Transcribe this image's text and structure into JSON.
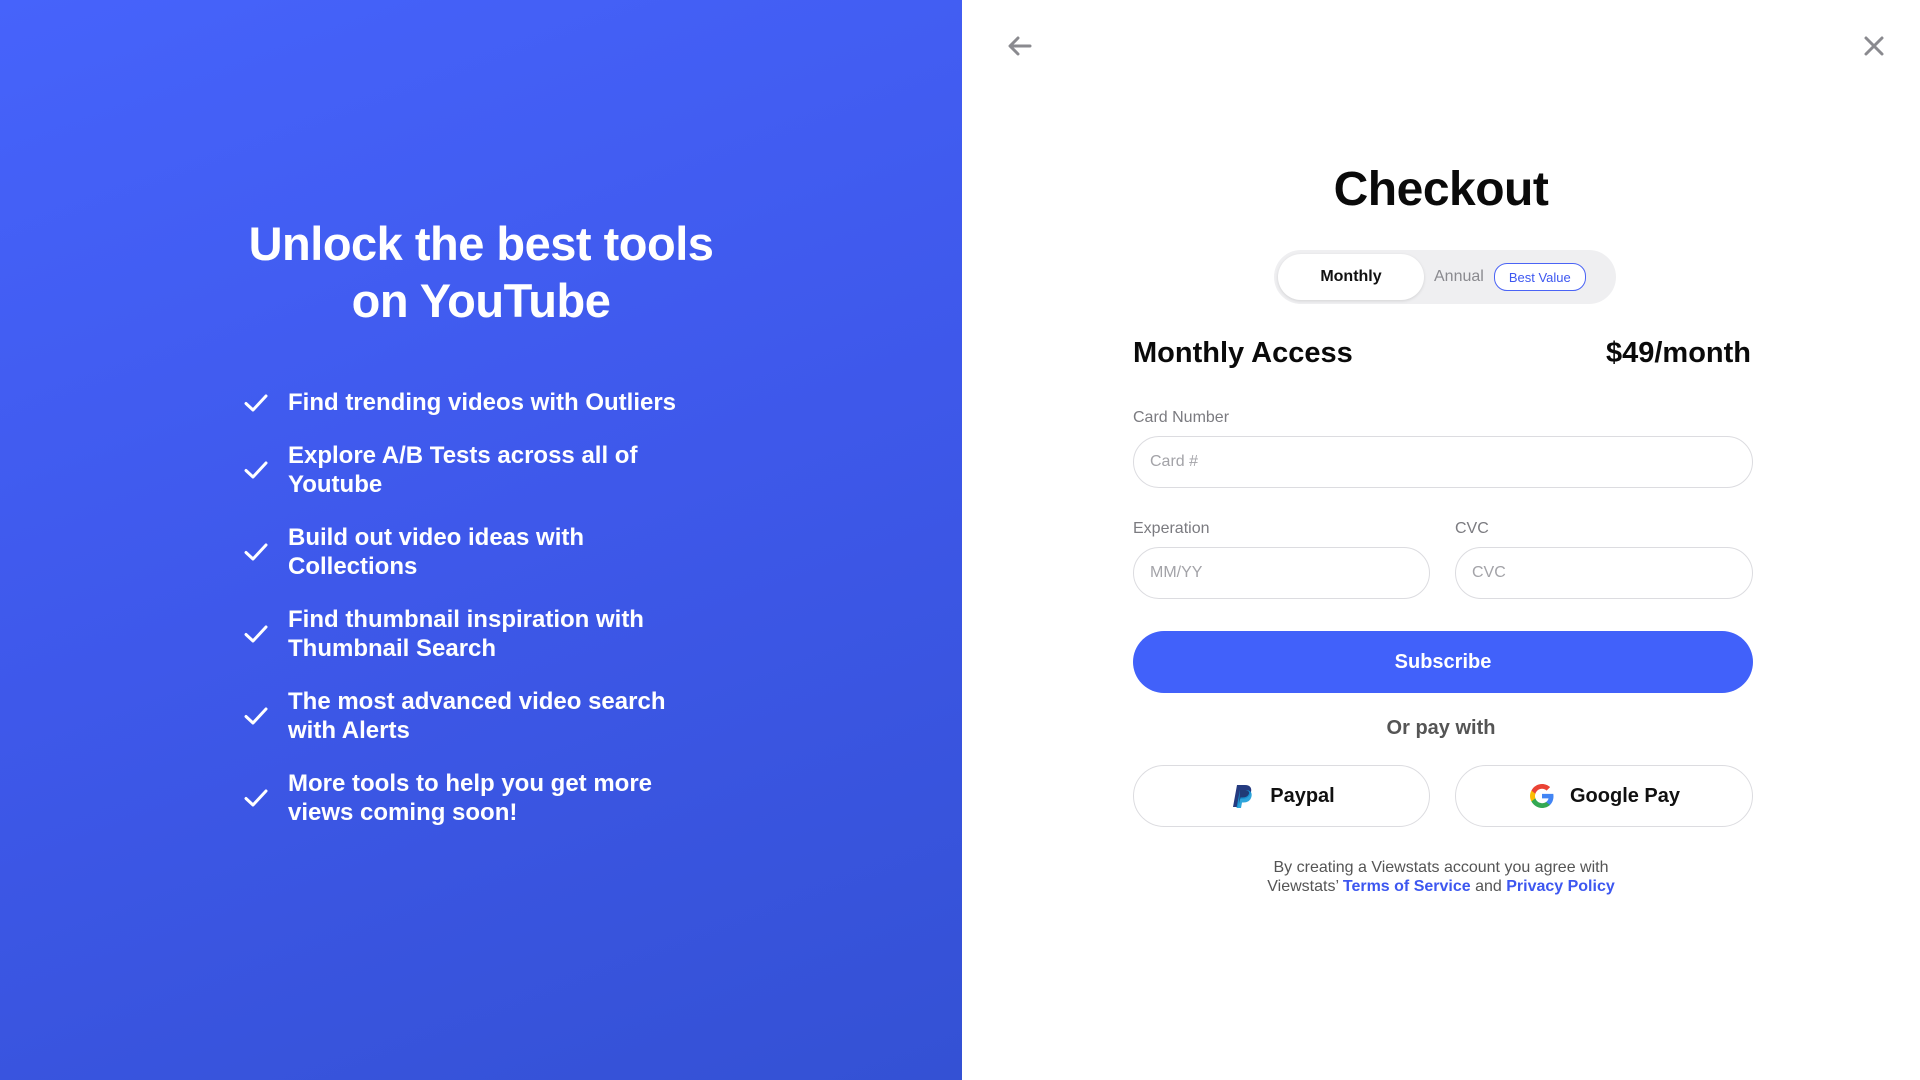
{
  "left": {
    "headline_line1": "Unlock the best tools",
    "headline_line2": "on YouTube",
    "features": [
      "Find trending videos with Outliers",
      "Explore A/B Tests across all of Youtube",
      "Build out video ideas with Collections",
      "Find thumbnail inspiration with Thumbnail Search",
      "The most advanced video search with Alerts",
      "More tools to help you get more views coming soon!"
    ]
  },
  "checkout": {
    "title": "Checkout",
    "toggle": {
      "monthly": "Monthly",
      "annual": "Annual",
      "badge": "Best Value"
    },
    "plan_name": "Monthly Access",
    "plan_price": "$49/month",
    "card_number_label": "Card Number",
    "card_number_placeholder": "Card #",
    "expiration_label": "Experation",
    "expiration_placeholder": "MM/YY",
    "cvc_label": "CVC",
    "cvc_placeholder": "CVC",
    "subscribe_label": "Subscribe",
    "or_pay_with": "Or pay with",
    "paypal_label": "Paypal",
    "google_pay_label": "Google Pay",
    "legal_line1": "By creating a Viewstats account you agree with",
    "legal_prefix": "Viewstats’ ",
    "terms_label": "Terms of Service",
    "legal_and": " and ",
    "privacy_label": "Privacy Policy"
  },
  "icons": {
    "back": "arrow-left-icon",
    "close": "close-icon",
    "check": "check-icon",
    "paypal": "paypal-icon",
    "google": "google-icon"
  },
  "colors": {
    "left_gradient_start": "#4663fb",
    "left_gradient_end": "#3451d4",
    "accent": "#4161fa",
    "link": "#3d57f0"
  }
}
